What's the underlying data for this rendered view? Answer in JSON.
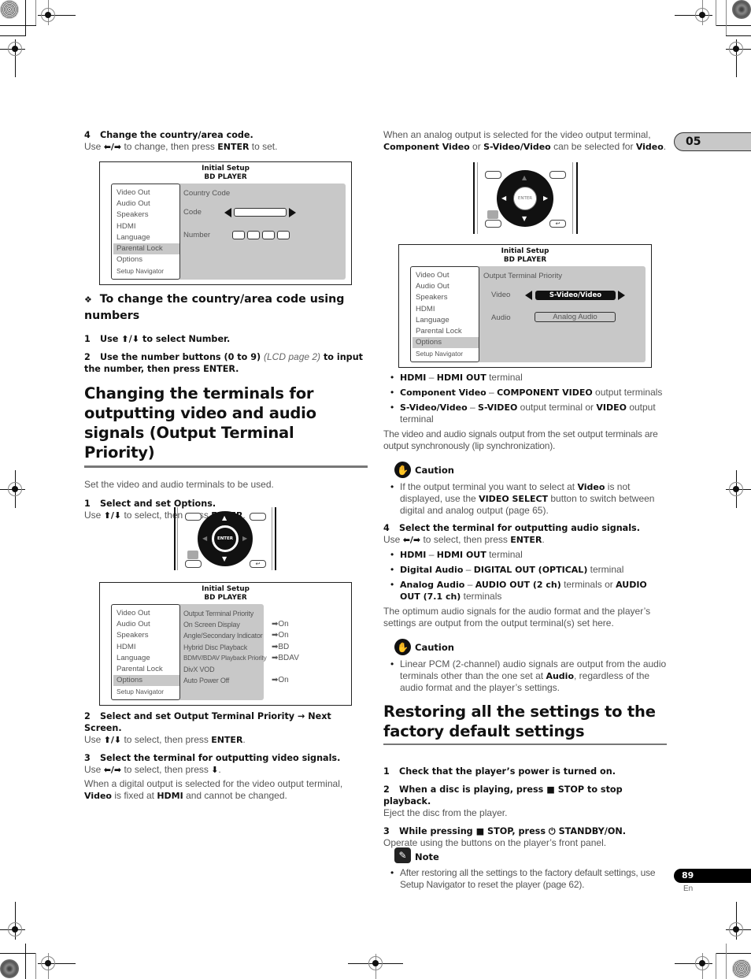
{
  "chapter_tab": "05",
  "page_number": "89",
  "language": "En",
  "left": {
    "step4": {
      "num": "4",
      "title": "Change the country/area code.",
      "body_pre": "Use ",
      "arrows": "⬅/➡",
      "body_mid": " to change, then press ",
      "body_bold": "ENTER",
      "body_post": " to set."
    },
    "screen1": {
      "title1": "Initial Setup",
      "title2": "BD PLAYER",
      "menu": [
        "Video Out",
        "Audio Out",
        "Speakers",
        "HDMI",
        "Language",
        "Parental Lock",
        "Options",
        "Setup Navigator"
      ],
      "selected": "Parental Lock",
      "panel_heading": "Country Code",
      "code_label": "Code",
      "number_label": "Number"
    },
    "subsection": {
      "symbol": "❖",
      "title": "To change the country/area code using numbers"
    },
    "sub_step1": {
      "num": "1",
      "pre": "Use ",
      "arrows": "⬆/⬇",
      "post": " to select Number."
    },
    "sub_step2": {
      "num": "2",
      "pre": "Use the number buttons (0 to 9) ",
      "italic": "(LCD page 2)",
      "post": " to input the number, then press ENTER."
    },
    "section_title": "Changing the terminals for outputting video and audio signals (Output Terminal Priority)",
    "section_intro": "Set the video and audio terminals to be used.",
    "step1": {
      "num": "1",
      "title": "Select and set Options.",
      "pre": "Use ",
      "arrows": "⬆/⬇",
      "mid": " to select, then press ",
      "bold": "ENTER",
      "post": "."
    },
    "remote1": {
      "enter_label": "ENTER"
    },
    "screen2": {
      "title1": "Initial Setup",
      "title2": "BD PLAYER",
      "menu": [
        "Video Out",
        "Audio Out",
        "Speakers",
        "HDMI",
        "Language",
        "Parental Lock",
        "Options",
        "Setup Navigator"
      ],
      "selected": "Options",
      "options": [
        {
          "label": "Output Terminal Priority",
          "value": ""
        },
        {
          "label": "On Screen Display",
          "value": "➡On"
        },
        {
          "label": "Angle/Secondary Indicator",
          "value": "➡On"
        },
        {
          "label": "Hybrid Disc Playback",
          "value": "➡BD"
        },
        {
          "label": "BDMV/BDAV Playback Priority",
          "value": "➡BDAV"
        },
        {
          "label": "DivX VOD",
          "value": ""
        },
        {
          "label": "Auto Power Off",
          "value": "➡On"
        }
      ]
    },
    "step2": {
      "num": "2",
      "title": "Select and set Output Terminal Priority → Next Screen.",
      "pre": "Use ",
      "arrows": "⬆/⬇",
      "mid": " to select, then press ",
      "bold": "ENTER",
      "post": "."
    },
    "step3": {
      "num": "3",
      "title": "Select the terminal for outputting video signals.",
      "pre": "Use ",
      "arrows": "⬅/➡",
      "mid": " to select, then press ",
      "down": "⬇",
      "post": "."
    },
    "step3_note": {
      "pre": "When a digital output is selected for the video output terminal, ",
      "b1": "Video",
      "mid": " is fixed at ",
      "b2": "HDMI",
      "post": " and cannot be changed."
    }
  },
  "right": {
    "analog_note": {
      "pre": "When an analog output is selected for the video output terminal, ",
      "b1": "Component Video",
      "mid1": " or ",
      "b2": "S-Video/Video",
      "mid2": " can be selected for ",
      "b3": "Video",
      "post": "."
    },
    "remote2": {
      "enter_label": "ENTER"
    },
    "screen3": {
      "title1": "Initial Setup",
      "title2": "BD PLAYER",
      "menu": [
        "Video Out",
        "Audio Out",
        "Speakers",
        "HDMI",
        "Language",
        "Parental Lock",
        "Options",
        "Setup Navigator"
      ],
      "selected": "Options",
      "panel_heading": "Output Terminal Priority",
      "video_label": "Video",
      "video_value": "S-Video/Video",
      "audio_label": "Audio",
      "audio_value": "Analog Audio"
    },
    "video_bullets": [
      {
        "b1": "HDMI",
        "dash": " – ",
        "b2": "HDMI OUT",
        "rest": " terminal",
        "b3": "",
        "rest2": ""
      },
      {
        "b1": "Component Video",
        "dash": " – ",
        "b2": "COMPONENT VIDEO",
        "rest": " output terminals",
        "b3": "",
        "rest2": ""
      },
      {
        "b1": "S-Video/Video",
        "dash": " – ",
        "b2": "S-VIDEO",
        "rest": " output terminal or ",
        "b3": "VIDEO",
        "rest2": " output terminal"
      }
    ],
    "lip_sync": "The video and audio signals output from the set output terminals are output synchronously (lip synchronization).",
    "caution1": {
      "title": "Caution",
      "pre": "If the output terminal you want to select at ",
      "b1": "Video",
      "mid": " is not displayed, use the ",
      "b2": "VIDEO SELECT",
      "post": " button to switch between digital and analog output (page 65)."
    },
    "step4": {
      "num": "4",
      "title": "Select the terminal for outputting audio signals.",
      "pre": "Use ",
      "arrows": "⬅/➡",
      "mid": " to select, then press ",
      "bold": "ENTER",
      "post": "."
    },
    "audio_bullets": [
      {
        "b1": "HDMI",
        "dash": " – ",
        "b2": "HDMI OUT",
        "rest": " terminal",
        "b3": "",
        "rest2": ""
      },
      {
        "b1": "Digital Audio",
        "dash": " – ",
        "b2": "DIGITAL OUT (OPTICAL)",
        "rest": " terminal",
        "b3": "",
        "rest2": ""
      },
      {
        "b1": "Analog Audio",
        "dash": " – ",
        "b2": "AUDIO OUT (2 ch)",
        "rest": " terminals or ",
        "b3": "AUDIO OUT (7.1 ch)",
        "rest2": " terminals"
      }
    ],
    "optimum": "The optimum audio signals for the audio format and the player’s settings are output from the output terminal(s) set here.",
    "caution2": {
      "title": "Caution",
      "pre": "Linear PCM (2-channel) audio signals are output from the audio terminals other than the one set at ",
      "b1": "Audio",
      "post": ", regardless of the audio format and the player’s settings."
    },
    "section_title": "Restoring all the settings to the factory default settings",
    "r_step1": {
      "num": "1",
      "title": "Check that the player’s power is turned on."
    },
    "r_step2": {
      "num": "2",
      "title": "When a disc is playing, press ■ STOP to stop playback.",
      "body": "Eject the disc from the player."
    },
    "r_step3": {
      "num": "3",
      "title": "While pressing ■ STOP, press ⏻ STANDBY/ON.",
      "body": "Operate using the buttons on the player’s front panel."
    },
    "note": {
      "title": "Note",
      "body": "After restoring all the settings to the factory default settings, use Setup Navigator to reset the player (page 62)."
    }
  }
}
